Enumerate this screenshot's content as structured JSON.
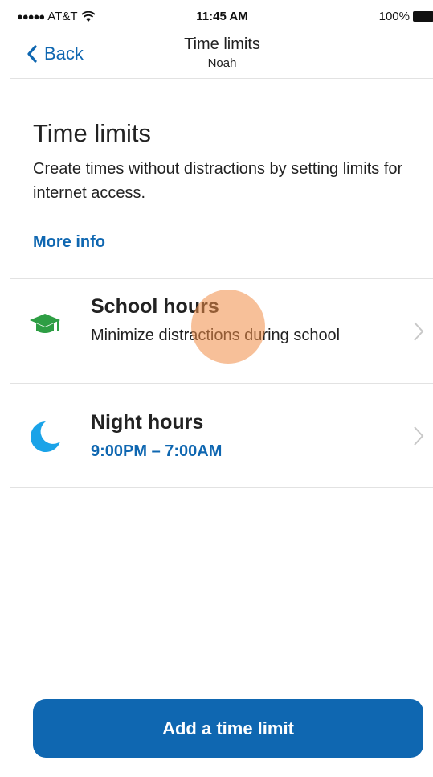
{
  "status_bar": {
    "carrier": "AT&T",
    "signal": "●●●●●",
    "time": "11:45 AM",
    "battery": "100%"
  },
  "nav": {
    "back_label": "Back",
    "title": "Time limits",
    "subtitle": "Noah"
  },
  "intro": {
    "title": "Time limits",
    "description": "Create times without distractions by setting limits for internet access.",
    "more_info": "More info"
  },
  "limits": [
    {
      "title": "School hours",
      "subtitle": "Minimize distractions during school",
      "icon": "graduation-cap-icon",
      "icon_color": "#2e9e44"
    },
    {
      "title": "Night hours",
      "subtitle": "9:00PM – 7:00AM",
      "icon": "moon-icon",
      "icon_color": "#1aa3e8"
    }
  ],
  "add_button_label": "Add a time limit",
  "colors": {
    "accent": "#0f67b1",
    "touch": "#f08c46"
  }
}
